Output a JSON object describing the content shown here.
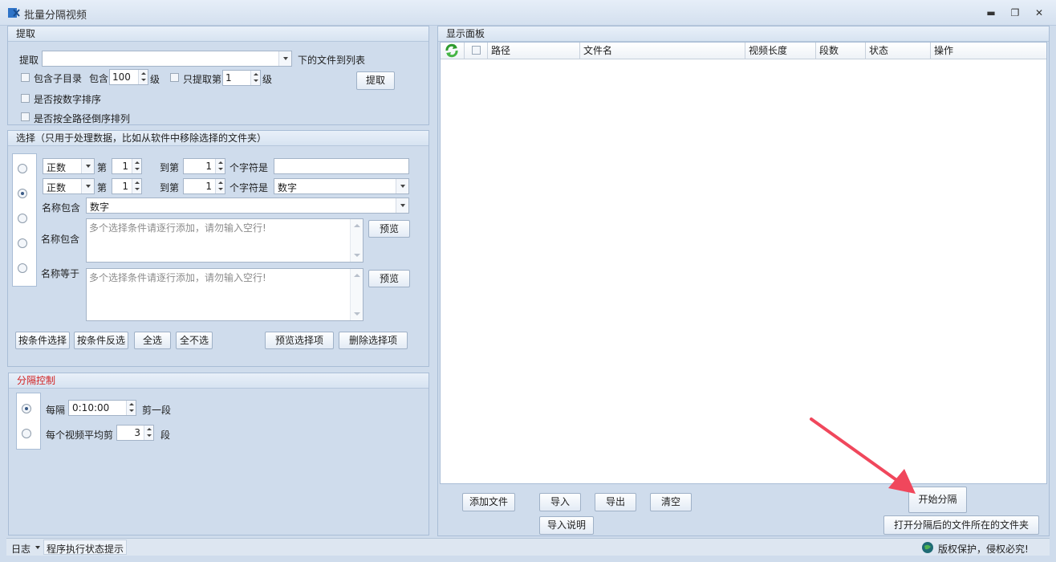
{
  "window": {
    "title": "批量分隔视频",
    "minimize": "▬",
    "restore": "❐",
    "close": "✕"
  },
  "extract": {
    "header": "提取",
    "label": "提取",
    "path_value": "",
    "suffix": "下的文件到列表",
    "include_sub": "包含子目录",
    "include": "包含",
    "depth_value": "100",
    "level": "级",
    "only_extract": "只提取第",
    "only_value": "1",
    "level2": "级",
    "sort_numeric": "是否按数字排序",
    "sort_path_desc": "是否按全路径倒序排列",
    "button": "提取"
  },
  "select": {
    "header": "选择（只用于处理数据，比如从软件中移除选择的文件夹）",
    "row1": {
      "mode": "正数",
      "from_label": "第",
      "from_value": "1",
      "to_label": "到第",
      "to_value": "1",
      "chars_label": "个字符是",
      "text_value": ""
    },
    "row2": {
      "mode": "正数",
      "from_label": "第",
      "from_value": "1",
      "to_label": "到第",
      "to_value": "1",
      "chars_label": "个字符是",
      "type_value": "数字"
    },
    "row3": {
      "label": "名称包含",
      "value": "数字"
    },
    "row4": {
      "label": "名称包含",
      "placeholder": "多个选择条件请逐行添加，请勿输入空行!",
      "preview": "预览"
    },
    "row5": {
      "label": "名称等于",
      "placeholder": "多个选择条件请逐行添加，请勿输入空行!",
      "preview": "预览"
    },
    "buttons": {
      "by_condition": "按条件选择",
      "by_condition_invert": "按条件反选",
      "select_all": "全选",
      "select_none": "全不选",
      "preview_selected": "预览选择项",
      "delete_selected": "删除选择项"
    }
  },
  "split": {
    "header": "分隔控制",
    "every_label": "每隔",
    "every_value": "0:10:00",
    "every_suffix": "剪一段",
    "avg_label": "每个视频平均剪",
    "avg_value": "3",
    "avg_suffix": "段"
  },
  "display": {
    "header": "显示面板",
    "columns": [
      "路径",
      "文件名",
      "视频长度",
      "段数",
      "状态",
      "操作"
    ],
    "rows": []
  },
  "actions": {
    "add_file": "添加文件",
    "import": "导入",
    "export": "导出",
    "clear": "清空",
    "start": "开始分隔",
    "import_help": "导入说明",
    "open_folder": "打开分隔后的文件所在的文件夹"
  },
  "status": {
    "log": "日志",
    "hint": "程序执行状态提示",
    "copyright": "版权保护，侵权必究!"
  },
  "colors": {
    "accent_red": "#d22020",
    "arrow": "#f0475c"
  }
}
